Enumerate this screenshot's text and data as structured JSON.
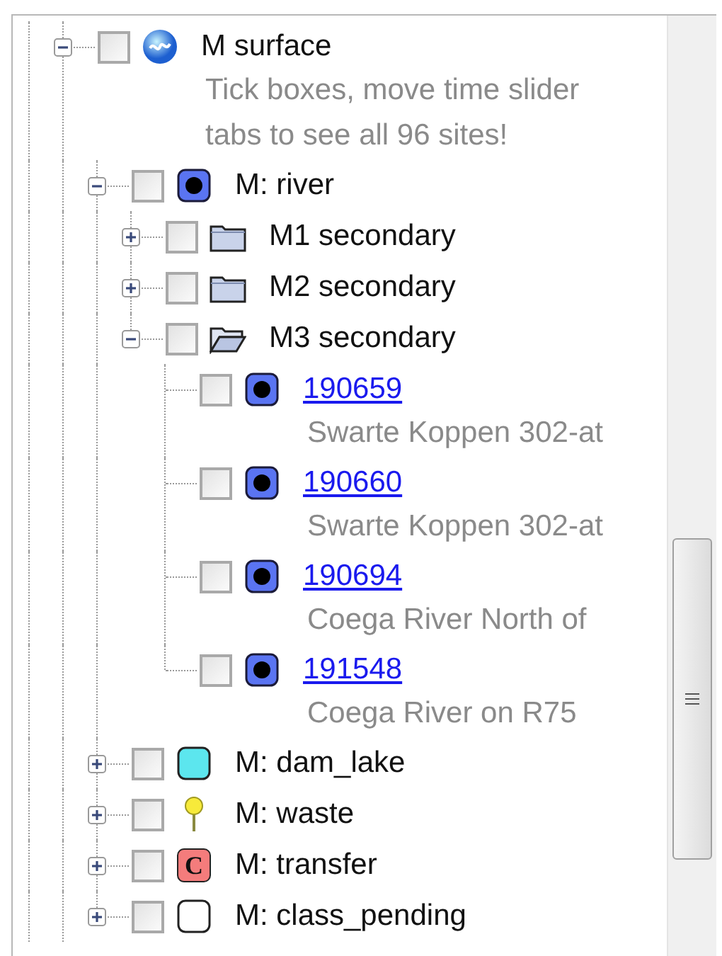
{
  "tree": [
    {
      "label": "M surface",
      "icon": {
        "kind": "globe"
      },
      "checked": false,
      "expanded": true,
      "description": "Tick boxes, move time slider tabs to see all 96 sites!",
      "children": [
        {
          "label": "M: river",
          "icon": {
            "kind": "marker"
          },
          "checked": false,
          "expanded": true,
          "children": [
            {
              "label": "M1 secondary",
              "icon": {
                "kind": "folder"
              },
              "checked": false,
              "expanded": false
            },
            {
              "label": "M2 secondary",
              "icon": {
                "kind": "folder"
              },
              "checked": false,
              "expanded": false
            },
            {
              "label": "M3 secondary",
              "icon": {
                "kind": "folder-open"
              },
              "checked": false,
              "expanded": true,
              "children": [
                {
                  "label": "190659",
                  "link": true,
                  "icon": {
                    "kind": "marker"
                  },
                  "checked": false,
                  "description": "Swarte Koppen 302-at"
                },
                {
                  "label": "190660",
                  "link": true,
                  "icon": {
                    "kind": "marker"
                  },
                  "checked": false,
                  "description": "Swarte Koppen 302-at"
                },
                {
                  "label": "190694",
                  "link": true,
                  "icon": {
                    "kind": "marker"
                  },
                  "checked": false,
                  "description": "Coega River North of"
                },
                {
                  "label": "191548",
                  "link": true,
                  "icon": {
                    "kind": "marker"
                  },
                  "checked": false,
                  "description": "Coega River on R75"
                }
              ]
            }
          ]
        },
        {
          "label": "M: dam_lake",
          "icon": {
            "kind": "square",
            "color": "#5ce6ee"
          },
          "checked": false,
          "expanded": false
        },
        {
          "label": "M: waste",
          "icon": {
            "kind": "pin"
          },
          "checked": false,
          "expanded": false
        },
        {
          "label": "M: transfer",
          "icon": {
            "kind": "letter",
            "text": "C",
            "color": "#f47c7c"
          },
          "checked": false,
          "expanded": false
        },
        {
          "label": "M: class_pending",
          "icon": {
            "kind": "square",
            "color": "#ffffff"
          },
          "checked": false,
          "expanded": false
        }
      ]
    }
  ]
}
